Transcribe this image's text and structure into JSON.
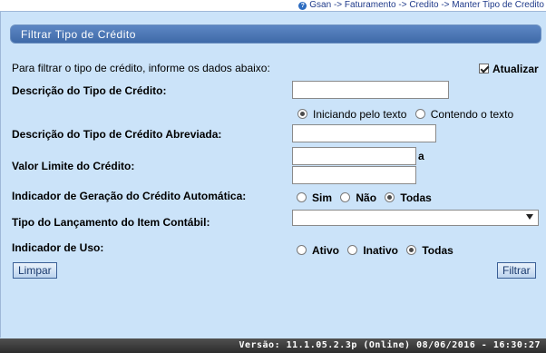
{
  "breadcrumb": "Gsan -> Faturamento -> Credito -> Manter Tipo de Credito",
  "title": "Filtrar Tipo de Crédito",
  "instructions": "Para filtrar o tipo de crédito, informe os dados abaixo:",
  "atualizar": {
    "label": "Atualizar",
    "checked": true
  },
  "fields": {
    "descricao": {
      "label": "Descrição do Tipo de Crédito:",
      "value": ""
    },
    "match_options": [
      "Iniciando pelo texto",
      "Contendo o texto"
    ],
    "descricao_abreviada": {
      "label": "Descrição do Tipo de Crédito Abreviada:",
      "value": ""
    },
    "valor_limite": {
      "label": "Valor Limite do Crédito:",
      "separator": "a",
      "from": "",
      "to": ""
    },
    "geracao_automatica": {
      "label": "Indicador de Geração do Crédito Automática:",
      "options": [
        "Sim",
        "Não",
        "Todas"
      ],
      "selected": "Todas"
    },
    "lancamento_contabil": {
      "label": "Tipo do Lançamento do Item Contábil:",
      "value": ""
    },
    "indicador_uso": {
      "label": "Indicador de Uso:",
      "options": [
        "Ativo",
        "Inativo",
        "Todas"
      ],
      "selected": "Todas"
    }
  },
  "buttons": {
    "limpar": "Limpar",
    "filtrar": "Filtrar"
  },
  "footer": "Versão: 11.1.05.2.3p (Online) 08/06/2016 - 16:30:27",
  "colors": {
    "background": "#cbe3f9",
    "titlebar": "#4d78b8",
    "footer": "#3a3a3a"
  }
}
